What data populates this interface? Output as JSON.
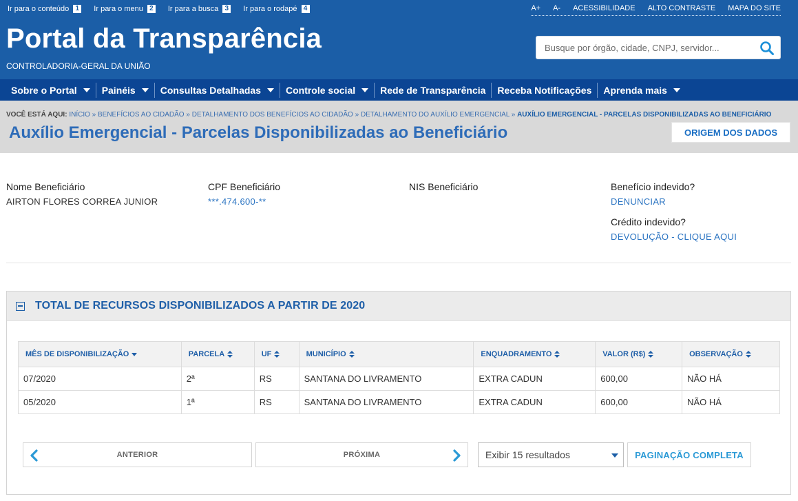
{
  "skip_links": [
    {
      "label": "Ir para o conteúdo",
      "num": "1"
    },
    {
      "label": "Ir para o menu",
      "num": "2"
    },
    {
      "label": "Ir para a busca",
      "num": "3"
    },
    {
      "label": "Ir para o rodapé",
      "num": "4"
    }
  ],
  "accessibility": {
    "font_up": "A+",
    "font_down": "A-",
    "accessibility": "ACESSIBILIDADE",
    "contrast": "ALTO CONTRASTE",
    "sitemap": "MAPA DO SITE"
  },
  "header": {
    "title": "Portal da Transparência",
    "subtitle": "CONTROLADORIA-GERAL DA UNIÃO",
    "search_placeholder": "Busque por órgão, cidade, CNPJ, servidor...",
    "search_icon": "search-icon",
    "brand_color": "#1b5ea7"
  },
  "nav": [
    {
      "label": "Sobre o Portal",
      "dropdown": true
    },
    {
      "label": "Painéis",
      "dropdown": true
    },
    {
      "label": "Consultas Detalhadas",
      "dropdown": true
    },
    {
      "label": "Controle social",
      "dropdown": true
    },
    {
      "label": "Rede de Transparência",
      "dropdown": false
    },
    {
      "label": "Receba Notificações",
      "dropdown": false
    },
    {
      "label": "Aprenda mais",
      "dropdown": true
    }
  ],
  "breadcrumb": {
    "lead": "VOCÊ ESTÁ AQUI:",
    "items": [
      "INÍCIO",
      "BENEFÍCIOS AO CIDADÃO",
      "DETALHAMENTO DOS BENEFÍCIOS AO CIDADÃO",
      "DETALHAMENTO DO AUXÍLIO EMERGENCIAL"
    ],
    "current": "AUXÍLIO EMERGENCIAL - PARCELAS DISPONIBILIZADAS AO BENEFICIÁRIO",
    "separator": "»"
  },
  "page": {
    "title": "Auxílio Emergencial - Parcelas Disponibilizadas ao Beneficiário",
    "origin_button": "ORIGEM DOS DADOS"
  },
  "beneficiary": {
    "name_label": "Nome Beneficiário",
    "name": "AIRTON FLORES CORREA JUNIOR",
    "cpf_label": "CPF Beneficiário",
    "cpf": "***.474.600-**",
    "nis_label": "NIS Beneficiário",
    "nis": "",
    "undue_benefit_label": "Benefício indevido?",
    "undue_benefit_link": "DENUNCIAR",
    "undue_credit_label": "Crédito indevido?",
    "undue_credit_link": "DEVOLUÇÃO - CLIQUE AQUI"
  },
  "panel": {
    "title": "TOTAL DE RECURSOS DISPONIBILIZADOS A PARTIR DE 2020",
    "columns": [
      "MÊS DE DISPONIBILIZAÇÃO",
      "PARCELA",
      "UF",
      "MUNICÍPIO",
      "ENQUADRAMENTO",
      "VALOR (R$)",
      "OBSERVAÇÃO"
    ],
    "rows": [
      [
        "07/2020",
        "2ª",
        "RS",
        "SANTANA DO LIVRAMENTO",
        "EXTRA CADUN",
        "600,00",
        "NÃO HÁ"
      ],
      [
        "05/2020",
        "1ª",
        "RS",
        "SANTANA DO LIVRAMENTO",
        "EXTRA CADUN",
        "600,00",
        "NÃO HÁ"
      ]
    ]
  },
  "pagination": {
    "previous": "ANTERIOR",
    "next": "PRÓXIMA",
    "results_selected": "Exibir 15 resultados",
    "full": "PAGINAÇÃO COMPLETA"
  }
}
